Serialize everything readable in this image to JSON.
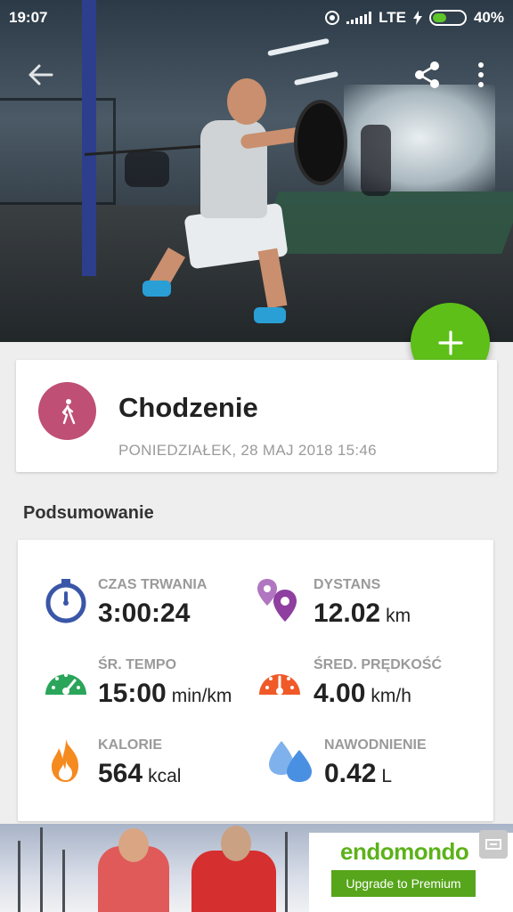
{
  "status_bar": {
    "time": "19:07",
    "network": "LTE",
    "battery": "40%",
    "battery_level": 0.4
  },
  "toolbar": {
    "back_icon": "arrow-left-icon",
    "share_icon": "share-icon",
    "more_icon": "more-vert-icon"
  },
  "fab": {
    "icon": "plus-icon",
    "color": "#5dbf18"
  },
  "activity": {
    "title": "Chodzenie",
    "date": "PONIEDZIAŁEK, 28 MAJ 2018 15:46",
    "icon": "walking-icon",
    "avatar_color": "#bf4f74"
  },
  "summary": {
    "section_title": "Podsumowanie",
    "stats": [
      {
        "label": "CZAS TRWANIA",
        "value": "3:00:24",
        "unit": "",
        "icon": "stopwatch-icon",
        "color": "#3a56a8"
      },
      {
        "label": "DYSTANS",
        "value": "12.02",
        "unit": "km",
        "icon": "location-pins-icon",
        "color": "#8e3fa0"
      },
      {
        "label": "ŚR. TEMPO",
        "value": "15:00",
        "unit": "min/km",
        "icon": "pace-gauge-icon",
        "color": "#2aa55a"
      },
      {
        "label": "ŚRED. PRĘDKOŚĆ",
        "value": "4.00",
        "unit": "km/h",
        "icon": "speed-gauge-icon",
        "color": "#f05a28"
      },
      {
        "label": "KALORIE",
        "value": "564",
        "unit": "kcal",
        "icon": "flame-icon",
        "color": "#f58a1f"
      },
      {
        "label": "NAWODNIENIE",
        "value": "0.42",
        "unit": "L",
        "icon": "water-drops-icon",
        "color": "#4a90e2"
      }
    ]
  },
  "ad": {
    "brand": "endomondo",
    "cta": "Upgrade to Premium",
    "brand_color": "#5cb21a"
  }
}
